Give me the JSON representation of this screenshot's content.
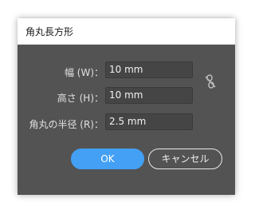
{
  "dialog": {
    "title": "角丸長方形",
    "fields": [
      {
        "label": "幅 (W)：",
        "value": "10 mm"
      },
      {
        "label": "高さ (H)：",
        "value": "10 mm"
      },
      {
        "label": "角丸の半径 (R)：",
        "value": "2.5 mm"
      }
    ],
    "link_icon": "unlinked-chain-icon",
    "buttons": {
      "ok_label": "OK",
      "cancel_label": "キャンセル"
    },
    "colors": {
      "panel": "#535353",
      "field_bg": "#454545",
      "accent": "#43a0f4"
    }
  }
}
